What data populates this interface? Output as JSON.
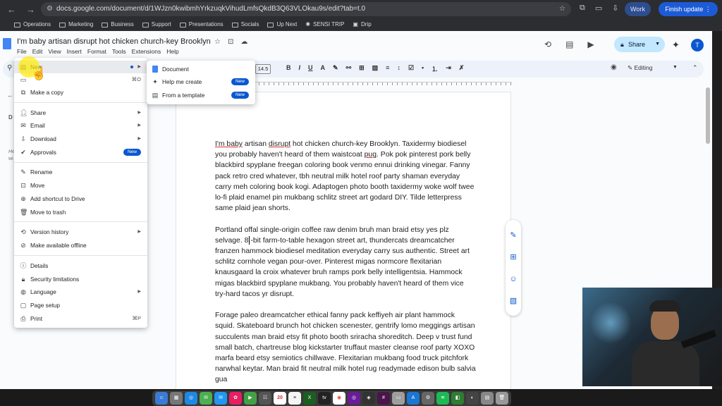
{
  "browser": {
    "url": "docs.google.com/document/d/1WJzn0kwibmhYrkzuqkVihudLmfsQkdB3Q63VLOkau9s/edit?tab=t.0",
    "profile": "Work",
    "update_label": "Finish update",
    "bookmarks": [
      "Operations",
      "Marketing",
      "Business",
      "Support",
      "Presentations",
      "Socials",
      "Up Next",
      "SENSI TRIP",
      "Drip"
    ]
  },
  "doc": {
    "title": "I'm baby artisan disrupt hot chicken church-key Brooklyn",
    "menus": [
      "File",
      "Edit",
      "View",
      "Insert",
      "Format",
      "Tools",
      "Extensions",
      "Help"
    ],
    "share_label": "Share",
    "avatar_initial": "T",
    "font_size": "14.5",
    "mode_label": "Editing",
    "sidebar_letter": "D",
    "sidebar_text_1": "He",
    "sidebar_text_2": "wi",
    "paragraph1_a": "I'm baby",
    "paragraph1_b": " artisan ",
    "paragraph1_c": "disrupt",
    "paragraph1_d": " hot chicken church-key Brooklyn. Taxidermy biodiesel you probably haven't heard of them waistcoat ",
    "paragraph1_e": "pug",
    "paragraph1_f": ". Pok pok pinterest pork belly blackbird spyplane freegan coloring book venmo ennui drinking vinegar. Fanny pack retro cred whatever, tbh neutral milk hotel roof party shaman everyday carry meh coloring book kogi. Adaptogen photo booth taxidermy woke wolf twee lo-fi plaid enamel pin mukbang schlitz street art godard DIY. Tilde letterpress same plaid jean shorts.",
    "paragraph2_a": "Portland offal single-origin coffee raw denim bruh man braid etsy yes plz selvage. 8",
    "paragraph2_b": "-bit farm-to-table hexagon street art, thundercats dreamcatcher franzen hammock biodiesel meditation everyday carry sus authentic. Street art schlitz cornhole vegan pour-over. Pinterest migas normcore flexitarian knausgaard la croix whatever bruh ramps pork belly intelligentsia. Hammock migas blackbird spyplane mukbang. You probably haven't heard of them vice try-hard tacos yr disrupt.",
    "paragraph3": "Forage paleo dreamcatcher ethical fanny pack keffiyeh air plant hammock squid. Skateboard brunch hot chicken scenester, gentrify lomo meggings artisan succulents man braid etsy fit photo booth sriracha shoreditch. Deep v trust fund small batch, chartreuse blog kickstarter truffaut master cleanse roof party XOXO marfa beard etsy semiotics chillwave. Flexitarian mukbang food truck pitchfork narwhal keytar. Man braid fit neutral milk hotel rug readymade edison bulb salvia gua"
  },
  "file_menu": {
    "new": "New",
    "open_shortcut": "⌘O",
    "make_copy": "Make a copy",
    "share": "Share",
    "email": "Email",
    "download": "Download",
    "approvals": "Approvals",
    "new_badge": "New",
    "rename": "Rename",
    "move": "Move",
    "add_shortcut": "Add shortcut to Drive",
    "move_trash": "Move to trash",
    "version_history": "Version history",
    "make_offline": "Make available offline",
    "details": "Details",
    "security": "Security limitations",
    "language": "Language",
    "page_setup": "Page setup",
    "print": "Print",
    "print_shortcut": "⌘P"
  },
  "submenu": {
    "document": "Document",
    "help_create": "Help me create",
    "from_template": "From a template",
    "badge": "New"
  },
  "dock": {
    "calendar_day": "20"
  }
}
